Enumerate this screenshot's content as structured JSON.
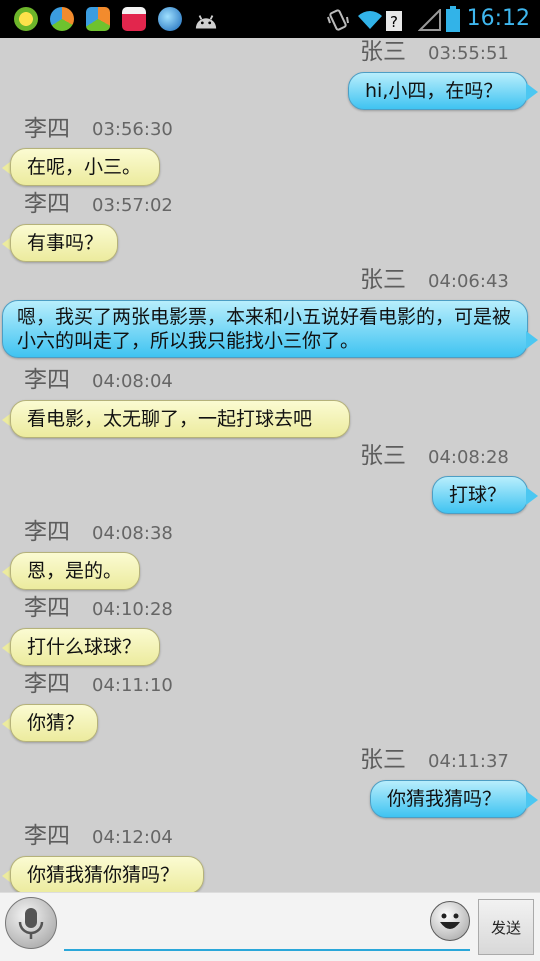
{
  "status_bar": {
    "time": "16:12",
    "icons": [
      "add-app-icon",
      "app-store-icon",
      "app-store-icon",
      "game-icon",
      "browser-globe-icon",
      "android-icon"
    ],
    "indicators": [
      "vibrate-icon",
      "wifi-icon",
      "no-signal-icon",
      "battery-icon"
    ]
  },
  "chat": {
    "messages": [
      {
        "sender": "张三",
        "time": "03:55:51",
        "side": "right",
        "text": "hi,小四，在吗？"
      },
      {
        "sender": "李四",
        "time": "03:56:30",
        "side": "left",
        "text": "在呢，小三。"
      },
      {
        "sender": "李四",
        "time": "03:57:02",
        "side": "left",
        "text": "有事吗？"
      },
      {
        "sender": "张三",
        "time": "04:06:43",
        "side": "right",
        "text": "嗯，我买了两张电影票，本来和小五说好看电影的，可是被小六的叫走了，所以我只能找小三你了。"
      },
      {
        "sender": "李四",
        "time": "04:08:04",
        "side": "left",
        "text": "看电影，太无聊了，一起打球去吧"
      },
      {
        "sender": "张三",
        "time": "04:08:28",
        "side": "right",
        "text": "打球？"
      },
      {
        "sender": "李四",
        "time": "04:08:38",
        "side": "left",
        "text": "恩，是的。"
      },
      {
        "sender": "李四",
        "time": "04:10:28",
        "side": "left",
        "text": "打什么球球？"
      },
      {
        "sender": "李四",
        "time": "04:11:10",
        "side": "left",
        "text": "你猜？"
      },
      {
        "sender": "张三",
        "time": "04:11:37",
        "side": "right",
        "text": "你猜我猜吗？"
      },
      {
        "sender": "李四",
        "time": "04:12:04",
        "side": "left",
        "text": "你猜我猜你猜吗？"
      }
    ]
  },
  "input_bar": {
    "message_value": "",
    "send_label": "发送"
  },
  "colors": {
    "background": "#cfcfcf",
    "left_bubble": "#eceb9e",
    "right_bubble": "#4cc7f1",
    "clock": "#3fb7ee",
    "input_underline": "#2aa7d9"
  }
}
